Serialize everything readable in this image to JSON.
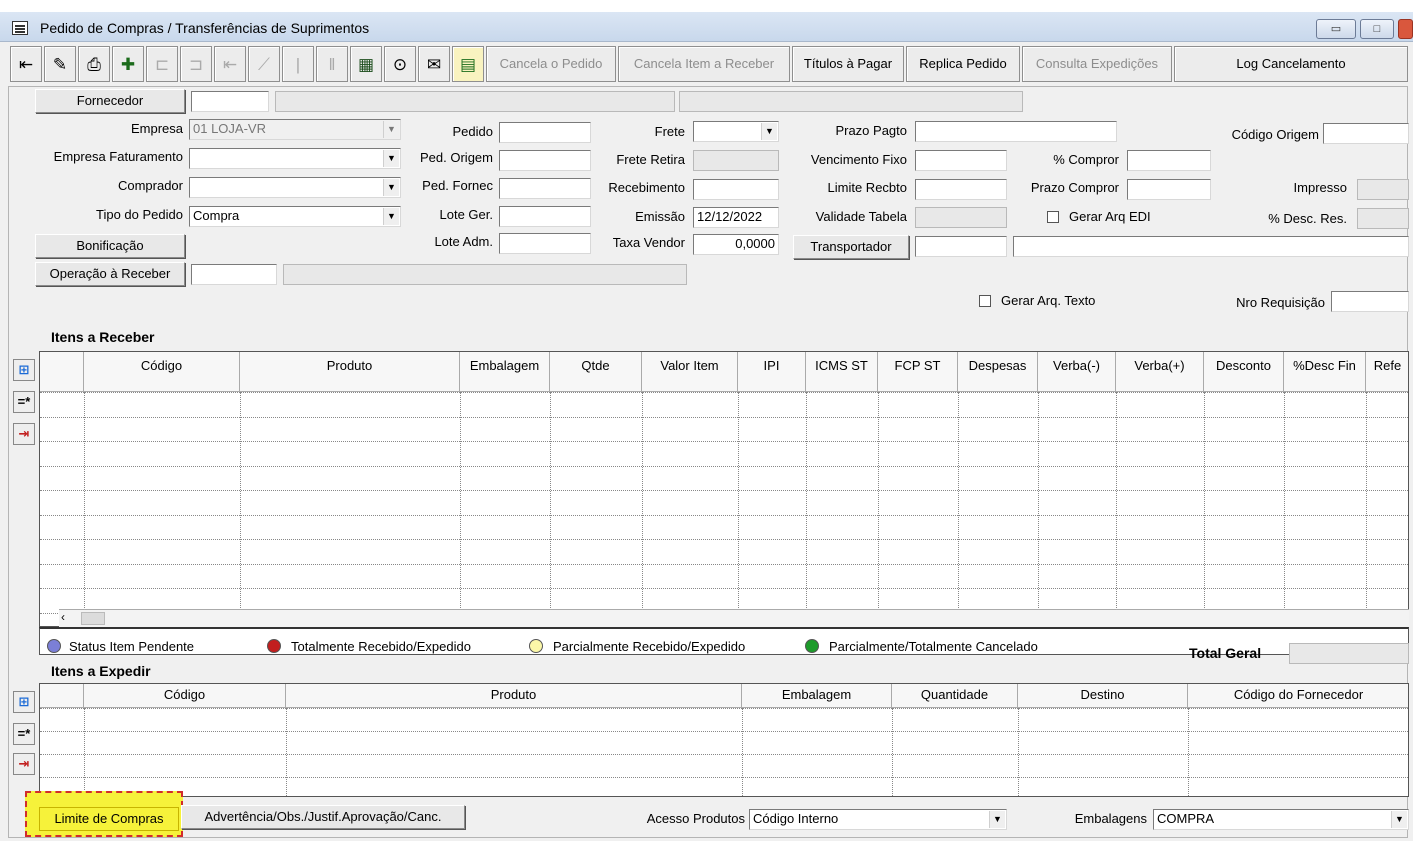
{
  "window": {
    "title": "Pedido de Compras / Transferências de Suprimentos"
  },
  "toolbar": {
    "buttons": [
      {
        "label": "Cancela o Pedido",
        "enabled": false
      },
      {
        "label": "Cancela Item a Receber",
        "enabled": false
      },
      {
        "label": "Títulos à Pagar",
        "enabled": true
      },
      {
        "label": "Replica Pedido",
        "enabled": true
      },
      {
        "label": "Consulta Expedições",
        "enabled": false
      },
      {
        "label": "Log Cancelamento",
        "enabled": true
      }
    ],
    "icons": [
      "exit-icon",
      "edit-pencil-icon",
      "print-icon",
      "add-record-icon",
      "first-record-icon",
      "last-record-icon",
      "first-icon",
      "prev-icon",
      "next-icon",
      "last-icon",
      "columns-icon",
      "binoculars-icon",
      "notes-icon",
      "calendar-grid-icon"
    ]
  },
  "form": {
    "fornecedor_btn": "Fornecedor",
    "empresa_label": "Empresa",
    "empresa_value": "01 LOJA-VR",
    "empresa_fat_label": "Empresa Faturamento",
    "comprador_label": "Comprador",
    "tipo_pedido_label": "Tipo do Pedido",
    "tipo_pedido_value": "Compra",
    "bonificacao_btn": "Bonificação",
    "operacao_btn": "Operação à Receber",
    "pedido_label": "Pedido",
    "ped_origem_label": "Ped. Origem",
    "ped_fornec_label": "Ped. Fornec",
    "lote_ger_label": "Lote Ger.",
    "lote_adm_label": "Lote Adm.",
    "frete_label": "Frete",
    "frete_retira_label": "Frete Retira",
    "recebimento_label": "Recebimento",
    "emissao_label": "Emissão",
    "emissao_value": "12/12/2022",
    "taxa_vendor_label": "Taxa Vendor",
    "taxa_vendor_value": "0,0000",
    "prazo_pagto_label": "Prazo Pagto",
    "vencimento_fixo_label": "Vencimento Fixo",
    "limite_recbto_label": "Limite Recbto",
    "validade_tabela_label": "Validade Tabela",
    "transportador_btn": "Transportador",
    "pct_compror_label": "% Compror",
    "prazo_compror_label": "Prazo Compror",
    "gerar_edi_label": "Gerar Arq EDI",
    "codigo_origem_label": "Código Origem",
    "impresso_label": "Impresso",
    "desc_res_label": "% Desc. Res.",
    "gerar_texto_label": "Gerar Arq. Texto",
    "nro_requisicao_label": "Nro Requisição"
  },
  "itens_receber": {
    "title": "Itens a Receber",
    "columns": [
      "Código",
      "Produto",
      "Embalagem",
      "Qtde",
      "Valor Item",
      "IPI",
      "ICMS ST",
      "FCP ST",
      "Despesas",
      "Verba(-)",
      "Verba(+)",
      "Desconto",
      "%Desc Fin",
      "Refe"
    ]
  },
  "legend": [
    {
      "label": "Status Item Pendente",
      "color": "#7b7fd6"
    },
    {
      "label": "Totalmente Recebido/Expedido",
      "color": "#c21f1f"
    },
    {
      "label": "Parcialmente Recebido/Expedido",
      "color": "#fbf7a8"
    },
    {
      "label": "Parcialmente/Totalmente Cancelado",
      "color": "#1e9b2b"
    }
  ],
  "total_geral_label": "Total Geral",
  "itens_expedir": {
    "title": "Itens a Expedir",
    "columns": [
      "Código",
      "Produto",
      "Embalagem",
      "Quantidade",
      "Destino",
      "Código do Fornecedor"
    ]
  },
  "bottom": {
    "limite_compras": "Limite de Compras",
    "advertencia": "Advertência/Obs./Justif.Aprovação/Canc.",
    "acesso_produtos_label": "Acesso Produtos",
    "acesso_produtos_value": "Código Interno",
    "embalagens_label": "Embalagens",
    "embalagens_value": "COMPRA"
  }
}
